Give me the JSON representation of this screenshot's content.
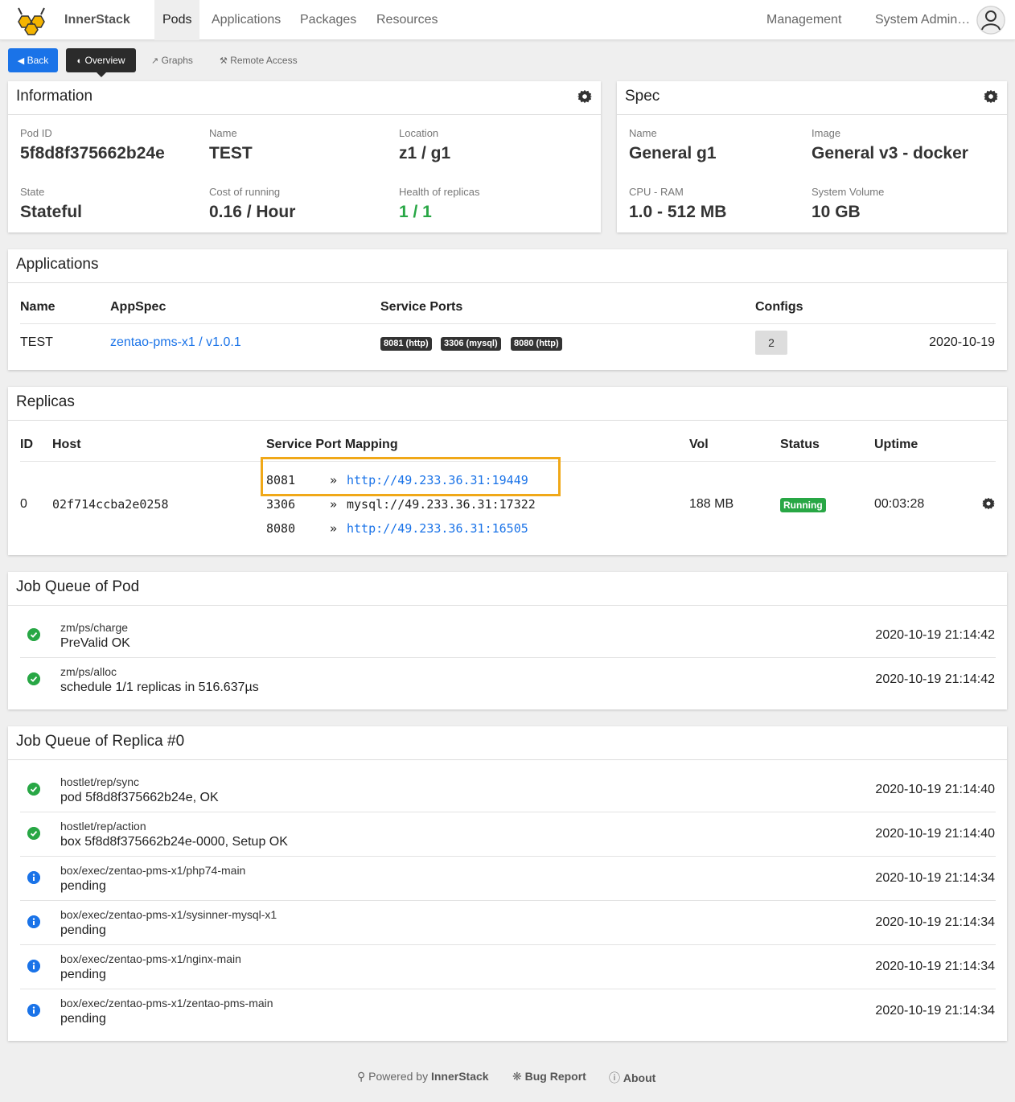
{
  "nav": {
    "brand": "InnerStack",
    "items": [
      "Pods",
      "Applications",
      "Packages",
      "Resources"
    ],
    "active": "Pods",
    "management": "Management",
    "user": "System Admin…"
  },
  "toolbar": {
    "back": "Back",
    "overview": "Overview",
    "graphs": "Graphs",
    "remote": "Remote Access"
  },
  "information": {
    "title": "Information",
    "pod_id_label": "Pod ID",
    "pod_id": "5f8d8f375662b24e",
    "name_label": "Name",
    "name": "TEST",
    "location_label": "Location",
    "location": "z1 / g1",
    "state_label": "State",
    "state": "Stateful",
    "cost_label": "Cost of running",
    "cost": "0.16 / Hour",
    "health_label": "Health of replicas",
    "health": "1 / 1"
  },
  "spec": {
    "title": "Spec",
    "name_label": "Name",
    "name": "General g1",
    "image_label": "Image",
    "image": "General v3 - docker",
    "cpu_label": "CPU - RAM",
    "cpu": "1.0 - 512 MB",
    "volume_label": "System Volume",
    "volume": "10 GB"
  },
  "applications": {
    "title": "Applications",
    "headers": {
      "name": "Name",
      "appspec": "AppSpec",
      "ports": "Service Ports",
      "configs": "Configs"
    },
    "row": {
      "name": "TEST",
      "appspec": "zentao-pms-x1 / v1.0.1",
      "ports": [
        "8081 (http)",
        "3306 (mysql)",
        "8080 (http)"
      ],
      "configs": "2",
      "date": "2020-10-19"
    }
  },
  "replicas": {
    "title": "Replicas",
    "headers": {
      "id": "ID",
      "host": "Host",
      "mapping": "Service Port Mapping",
      "vol": "Vol",
      "status": "Status",
      "uptime": "Uptime"
    },
    "row": {
      "id": "0",
      "host": "02f714ccba2e0258",
      "mappings": [
        {
          "port": "8081",
          "arrow": "»",
          "target": "http://49.233.36.31:19449"
        },
        {
          "port": "3306",
          "arrow": "»",
          "target": "mysql://49.233.36.31:17322"
        },
        {
          "port": "8080",
          "arrow": "»",
          "target": "http://49.233.36.31:16505"
        }
      ],
      "vol": "188 MB",
      "status": "Running",
      "uptime": "00:03:28"
    }
  },
  "pod_jobs": {
    "title": "Job Queue of Pod",
    "items": [
      {
        "path": "zm/ps/charge",
        "msg": "PreValid OK",
        "time": "2020-10-19 21:14:42",
        "icon": "check-circle-icon"
      },
      {
        "path": "zm/ps/alloc",
        "msg": "schedule 1/1 replicas in 516.637µs",
        "time": "2020-10-19 21:14:42",
        "icon": "check-circle-icon"
      }
    ]
  },
  "replica_jobs": {
    "title": "Job Queue of Replica #0",
    "items": [
      {
        "path": "hostlet/rep/sync",
        "msg": "pod 5f8d8f375662b24e, OK",
        "time": "2020-10-19 21:14:40",
        "icon": "check-circle-icon"
      },
      {
        "path": "hostlet/rep/action",
        "msg": "box 5f8d8f375662b24e-0000, Setup OK",
        "time": "2020-10-19 21:14:40",
        "icon": "check-circle-icon"
      },
      {
        "path": "box/exec/zentao-pms-x1/php74-main",
        "msg": "pending",
        "time": "2020-10-19 21:14:34",
        "icon": "info-circle-icon"
      },
      {
        "path": "box/exec/zentao-pms-x1/sysinner-mysql-x1",
        "msg": "pending",
        "time": "2020-10-19 21:14:34",
        "icon": "info-circle-icon"
      },
      {
        "path": "box/exec/zentao-pms-x1/nginx-main",
        "msg": "pending",
        "time": "2020-10-19 21:14:34",
        "icon": "info-circle-icon"
      },
      {
        "path": "box/exec/zentao-pms-x1/zentao-pms-main",
        "msg": "pending",
        "time": "2020-10-19 21:14:34",
        "icon": "info-circle-icon"
      }
    ]
  },
  "footer": {
    "powered": "Powered by",
    "powered_brand": "InnerStack",
    "bug": "Bug Report",
    "about": "About"
  },
  "colors": {
    "accent": "#1a73e8",
    "success": "#28a745",
    "highlight": "#f0a818",
    "dark": "#2b2b2b"
  }
}
